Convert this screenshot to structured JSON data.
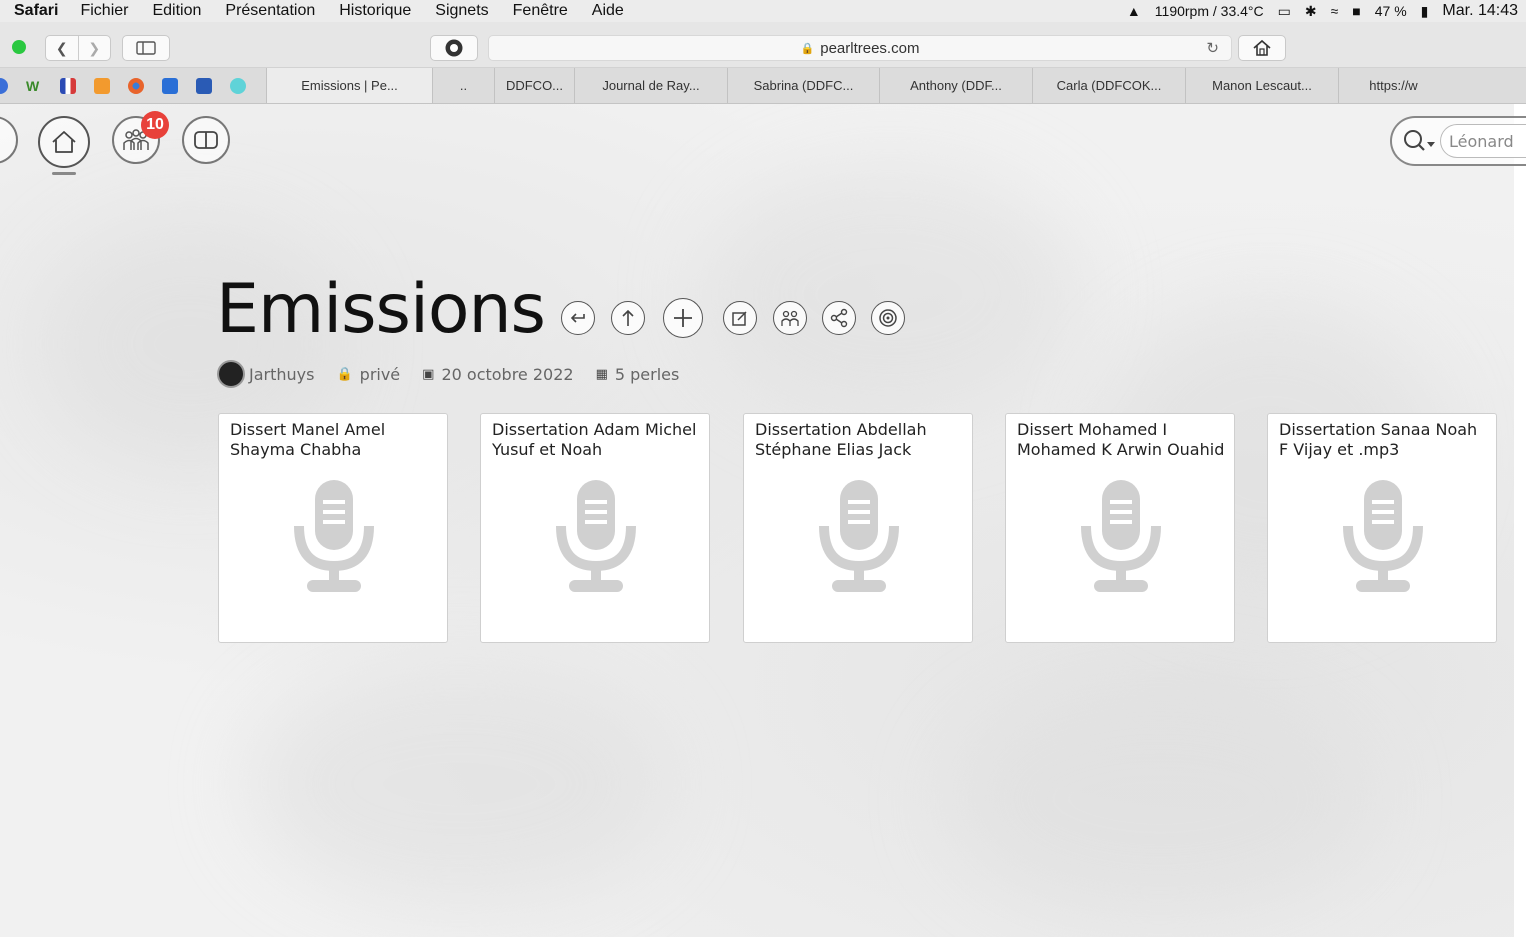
{
  "menubar": {
    "app": "Safari",
    "items": [
      "Fichier",
      "Edition",
      "Présentation",
      "Historique",
      "Signets",
      "Fenêtre",
      "Aide"
    ],
    "fan_status": "1190rpm / 33.4°C",
    "battery": "47 %",
    "clock": "Mar. 14:43"
  },
  "toolbar": {
    "url": "pearltrees.com"
  },
  "tabs": [
    {
      "label": "Emissions | Pe...",
      "active": true
    },
    {
      "label": "..",
      "active": false
    },
    {
      "label": "DDFCO...",
      "active": false
    },
    {
      "label": "Journal de Ray...",
      "active": false
    },
    {
      "label": "Sabrina (DDFC...",
      "active": false
    },
    {
      "label": "Anthony (DDF...",
      "active": false
    },
    {
      "label": "Carla (DDFCOK...",
      "active": false
    },
    {
      "label": "Manon Lescaut...",
      "active": false
    },
    {
      "label": "https://w",
      "active": false
    }
  ],
  "page": {
    "notifications_count": "10",
    "search_placeholder": "Léonard",
    "title": "Emissions",
    "meta": {
      "author": "Jarthuys",
      "privacy": "privé",
      "date": "20 octobre 2022",
      "count": "5 perles"
    },
    "cards": [
      {
        "title": "Dissert Manel Amel Shayma Chabha"
      },
      {
        "title": "Dissertation Adam Michel Yusuf et Noah"
      },
      {
        "title": "Dissertation Abdellah Stéphane Elias Jack"
      },
      {
        "title": "Dissert Mohamed I Mohamed K Arwin Ouahid"
      },
      {
        "title": "Dissertation Sanaa Noah F Vijay et .mp3"
      }
    ]
  },
  "colors": {
    "badge": "#e8413a",
    "green_dot": "#2ac840"
  },
  "icons": {
    "cards": "microphone-icon"
  }
}
